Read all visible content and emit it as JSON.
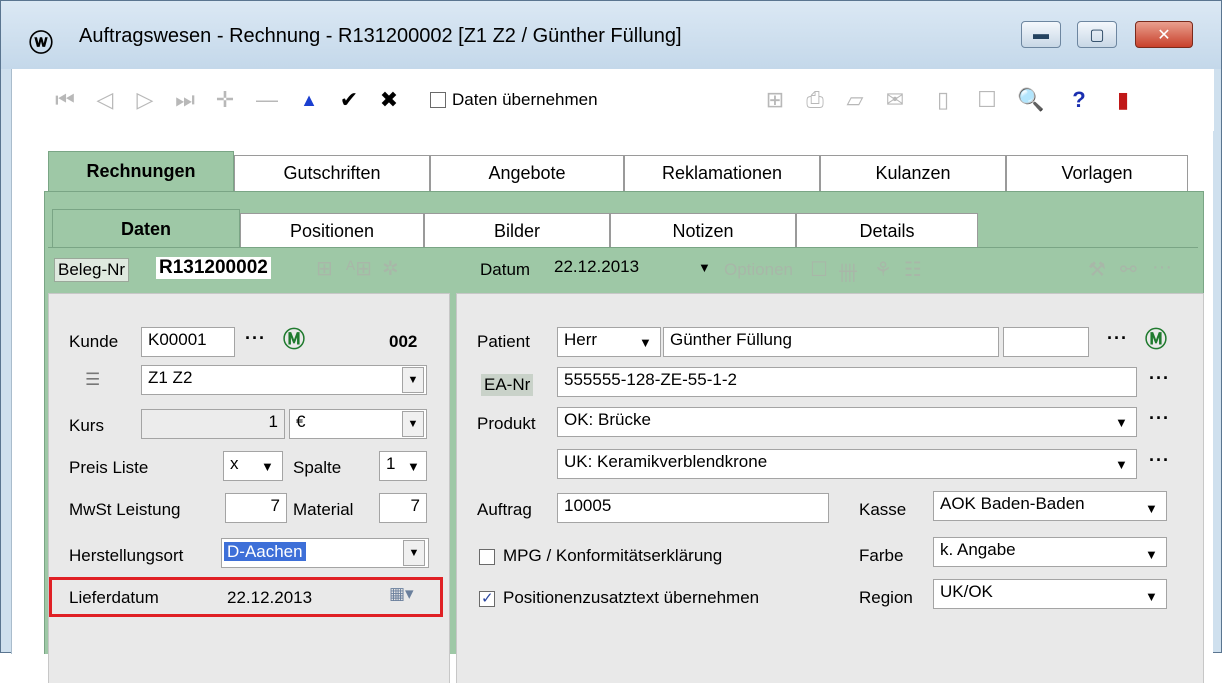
{
  "window": {
    "title": "Auftragswesen - Rechnung - R131200002 [Z1 Z2 / Günther Füllung]"
  },
  "toolbar": {
    "icons": [
      "first-icon",
      "prev-icon",
      "next-icon",
      "last-icon",
      "insert-icon",
      "delete-icon",
      "up-icon",
      "confirm-icon",
      "cancel-icon"
    ],
    "daten_uebernehmen": "Daten übernehmen",
    "help": "?"
  },
  "tabs_top": [
    "Rechnungen",
    "Gutschriften",
    "Angebote",
    "Reklamationen",
    "Kulanzen",
    "Vorlagen"
  ],
  "tabs_sub": [
    "Daten",
    "Positionen",
    "Bilder",
    "Notizen",
    "Details"
  ],
  "beleg": {
    "label": "Beleg-Nr",
    "value": "R131200002",
    "datum_label": "Datum",
    "datum_value": "22.12.2013",
    "optionen": "Optionen"
  },
  "left": {
    "kunde_label": "Kunde",
    "kunde_value": "K00001",
    "kunde_code": "002",
    "kunde_name": "Z1 Z2",
    "kurs_label": "Kurs",
    "kurs_value": "1",
    "currency": "€",
    "preisliste_label": "Preis Liste",
    "preisliste_value": "x",
    "spalte_label": "Spalte",
    "spalte_value": "1",
    "mwst_label": "MwSt Leistung",
    "mwst_value": "7",
    "material_label": "Material",
    "material_value": "7",
    "herstellungsort_label": "Herstellungsort",
    "herstellungsort_value": "D-Aachen",
    "lieferdatum_label": "Lieferdatum",
    "lieferdatum_value": "22.12.2013"
  },
  "right": {
    "patient_label": "Patient",
    "patient_anrede": "Herr",
    "patient_name": "Günther Füllung",
    "ea_label": "EA-Nr",
    "ea_value": "555555-128-ZE-55-1-2",
    "produkt_label": "Produkt",
    "produkt_ok": "OK: Brücke",
    "produkt_uk": "UK: Keramikverblendkrone",
    "auftrag_label": "Auftrag",
    "auftrag_value": "10005",
    "kasse_label": "Kasse",
    "kasse_value": "AOK Baden-Baden",
    "mpg_label": "MPG / Konformitätserklärung",
    "farbe_label": "Farbe",
    "farbe_value": "k. Angabe",
    "positionszusatz_label": "Positionenzusatztext übernehmen",
    "region_label": "Region",
    "region_value": "UK/OK"
  },
  "colors": {
    "tab_green": "#9ec8a6",
    "highlight_red": "#e02025",
    "selection_blue": "#3d6fd8"
  }
}
